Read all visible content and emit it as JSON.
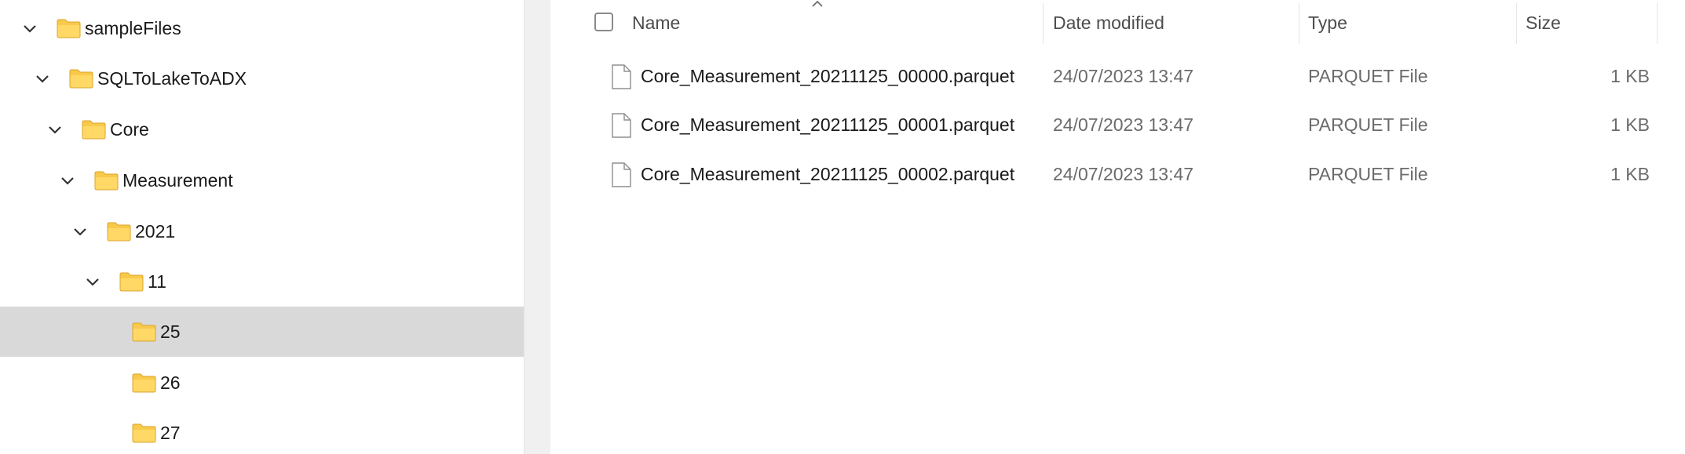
{
  "nav": {
    "tree": [
      {
        "label": "sampleFiles",
        "expanded": true,
        "selected": false
      },
      {
        "label": "SQLToLakeToADX",
        "expanded": true,
        "selected": false
      },
      {
        "label": "Core",
        "expanded": true,
        "selected": false
      },
      {
        "label": "Measurement",
        "expanded": true,
        "selected": false
      },
      {
        "label": "2021",
        "expanded": true,
        "selected": false
      },
      {
        "label": "11",
        "expanded": true,
        "selected": false
      },
      {
        "label": "25",
        "expanded": false,
        "selected": true
      },
      {
        "label": "26",
        "expanded": false,
        "selected": false
      },
      {
        "label": "27",
        "expanded": false,
        "selected": false
      }
    ]
  },
  "list": {
    "columns": {
      "name": "Name",
      "date": "Date modified",
      "type": "Type",
      "size": "Size"
    },
    "sorted_by": "Name",
    "files": [
      {
        "name": "Core_Measurement_20211125_00000.parquet",
        "date": "24/07/2023 13:47",
        "type": "PARQUET File",
        "size": "1 KB"
      },
      {
        "name": "Core_Measurement_20211125_00001.parquet",
        "date": "24/07/2023 13:47",
        "type": "PARQUET File",
        "size": "1 KB"
      },
      {
        "name": "Core_Measurement_20211125_00002.parquet",
        "date": "24/07/2023 13:47",
        "type": "PARQUET File",
        "size": "1 KB"
      }
    ]
  },
  "icons": {
    "folder": "folder-icon",
    "expand": "chevron-down-icon",
    "file": "document-icon",
    "sort": "sort-ascending-icon"
  },
  "colors": {
    "folder": "#f8c94a",
    "selected_row": "#d9d9d9",
    "header_text": "#4d4d4d",
    "secondary_text": "#6b6b6b"
  }
}
